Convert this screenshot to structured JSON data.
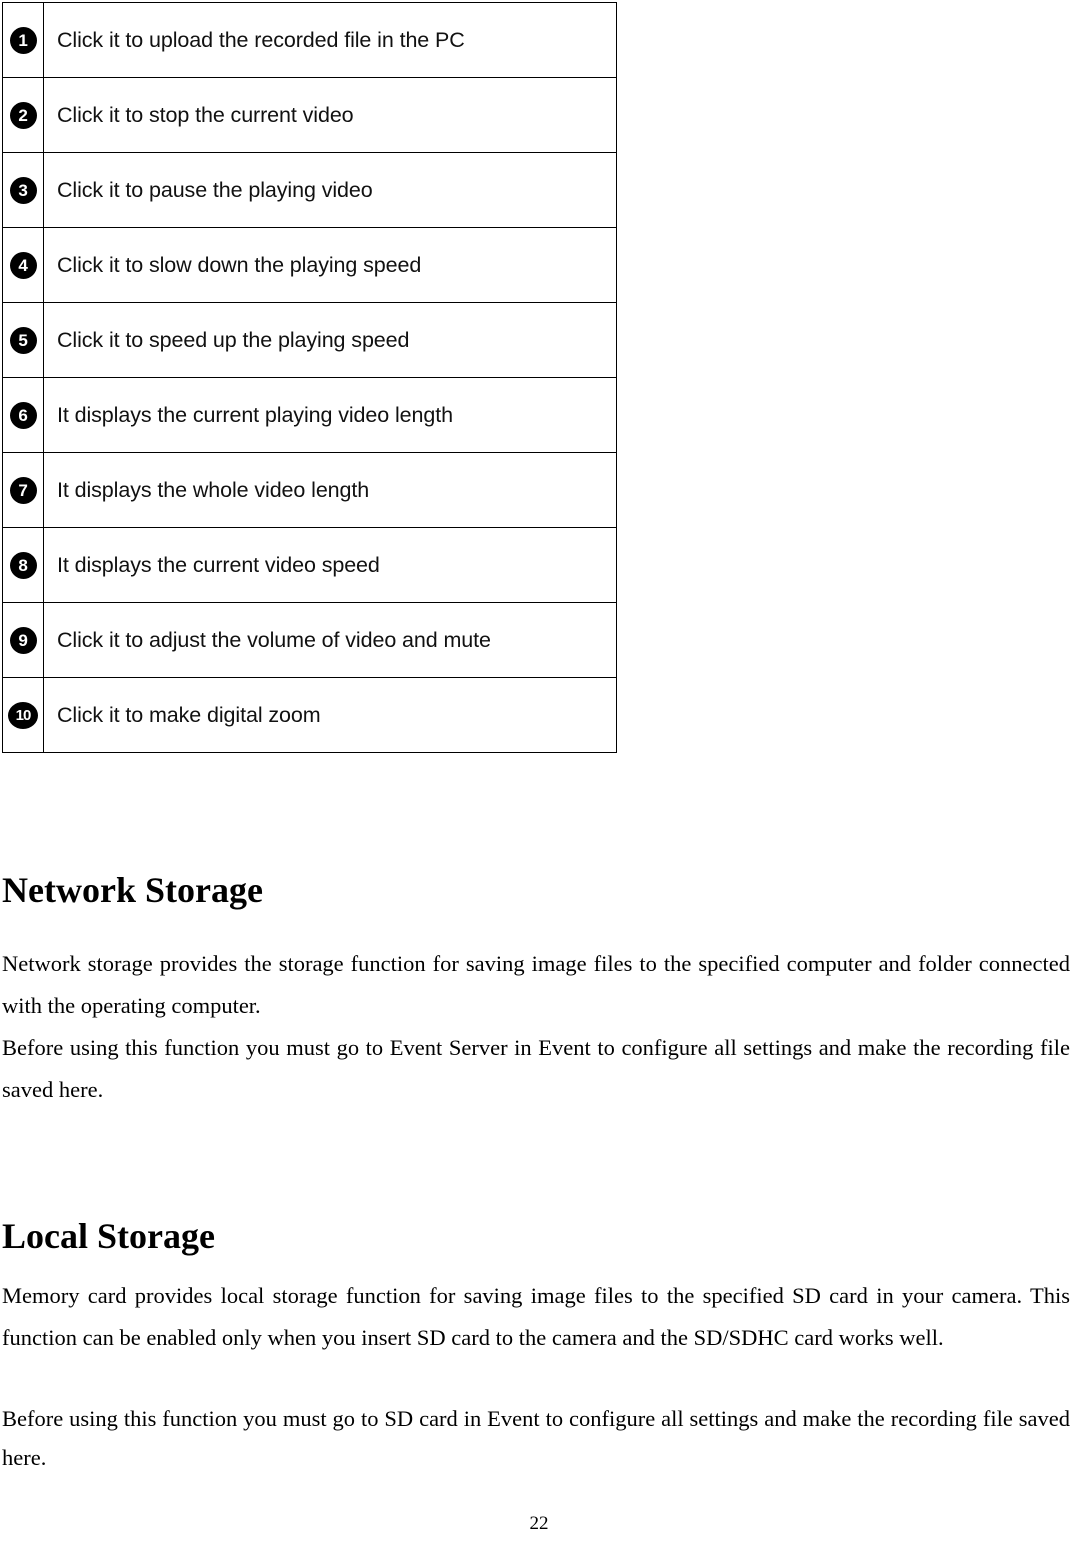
{
  "document": {
    "page_number": "22"
  },
  "legend_table": {
    "rows": [
      {
        "marker": "1",
        "glyph": "❶",
        "description": "Click it to upload the recorded file in the PC"
      },
      {
        "marker": "2",
        "glyph": "❷",
        "description": "Click it to stop the current video"
      },
      {
        "marker": "3",
        "glyph": "❸",
        "description": "Click it to pause the playing video"
      },
      {
        "marker": "4",
        "glyph": "❹",
        "description": "Click it to slow down the playing speed"
      },
      {
        "marker": "5",
        "glyph": "❺",
        "description": "Click it to speed up the playing speed"
      },
      {
        "marker": "6",
        "glyph": "❻",
        "description": "It displays the current playing video length"
      },
      {
        "marker": "7",
        "glyph": "❼",
        "description": "It displays the whole video length"
      },
      {
        "marker": "8",
        "glyph": "❽",
        "description": "It displays the current video speed"
      },
      {
        "marker": "9",
        "glyph": "❾",
        "description": "Click it to adjust the volume of video and mute"
      },
      {
        "marker": "10",
        "glyph": "❿",
        "description": "Click it to make digital zoom"
      }
    ]
  },
  "sections": [
    {
      "heading": "Network Storage",
      "paragraphs": [
        "Network storage provides the storage function for saving image files to the specified computer and folder connected with the operating computer.",
        "Before using this function you must go to Event Server in Event to configure all settings and make the recording file saved here."
      ]
    },
    {
      "heading": "Local Storage",
      "paragraphs": [
        "Memory card provides local storage function for saving image files to the specified SD card in your camera. This function can be enabled only when you insert SD card to the camera and the SD/SDHC card works well.",
        "Before using this function you must go to SD card in Event to configure all settings and make the recording file saved here."
      ]
    }
  ],
  "colors": {
    "text": "#000000",
    "badge_background": "#000000",
    "badge_text": "#ffffff",
    "table_border": "#000000",
    "page_background": "#ffffff"
  }
}
